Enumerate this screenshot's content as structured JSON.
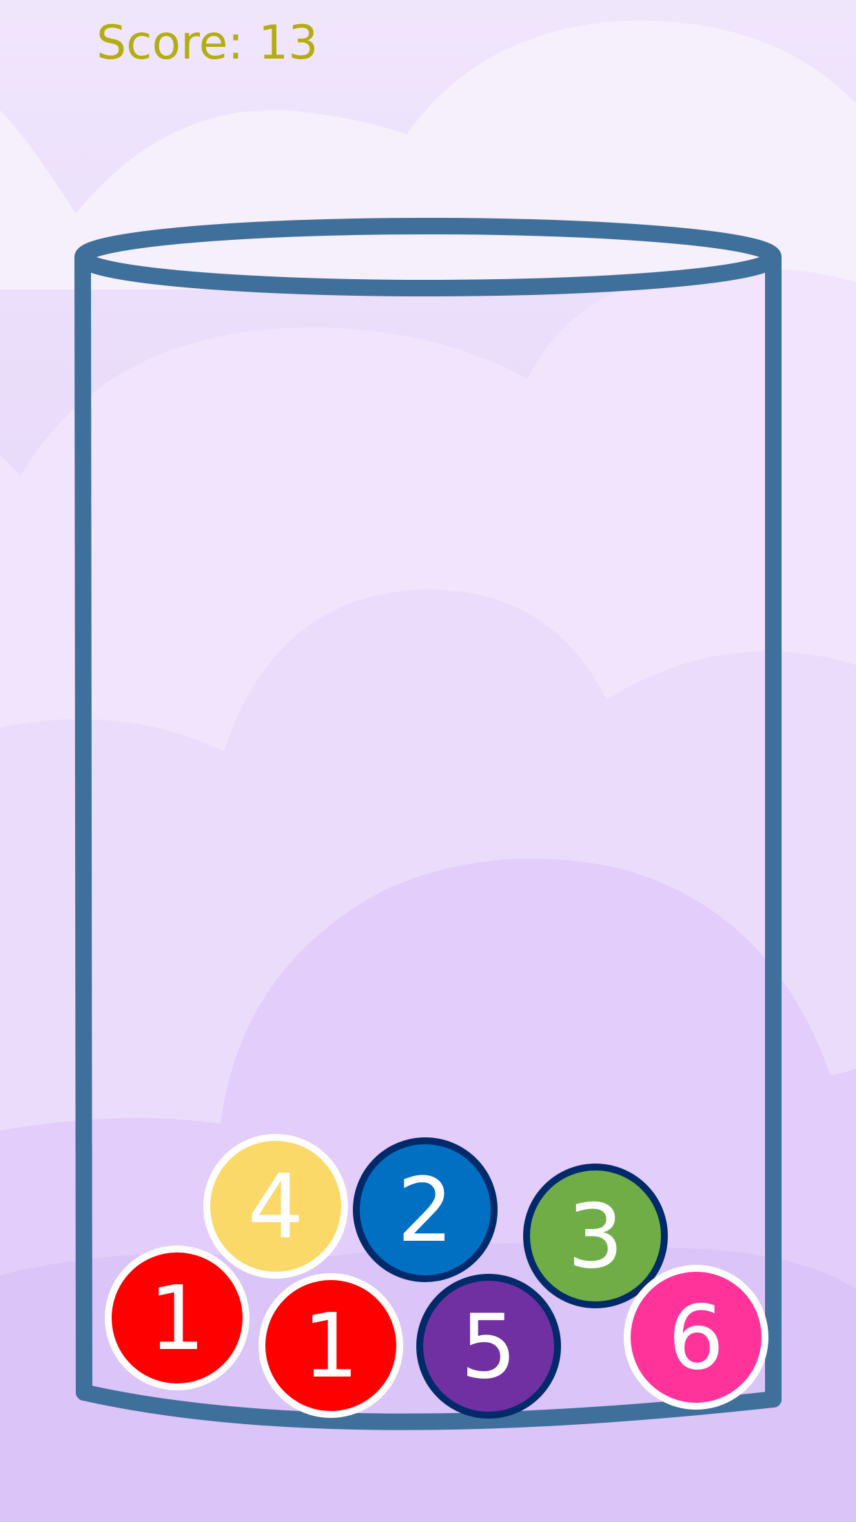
{
  "hud": {
    "score_label": "Score:",
    "score_value": "13"
  },
  "colors": {
    "sky_top": "#f0e6fc",
    "sky_bottom": "#d9c2f6",
    "glass_outline": "#3f6f9b",
    "score_text": "#b4ad12"
  },
  "balls": [
    {
      "number": "1",
      "fill": "#fe0000",
      "ring": "#ffffff"
    },
    {
      "number": "1",
      "fill": "#fe0000",
      "ring": "#ffffff"
    },
    {
      "number": "4",
      "fill": "#fbd968",
      "ring": "#ffffff"
    },
    {
      "number": "2",
      "fill": "#0270c2",
      "ring": "#012a6a"
    },
    {
      "number": "5",
      "fill": "#7130a2",
      "ring": "#012a6a"
    },
    {
      "number": "3",
      "fill": "#70ad47",
      "ring": "#012a6a"
    },
    {
      "number": "6",
      "fill": "#ff3399",
      "ring": "#ffffff"
    }
  ]
}
